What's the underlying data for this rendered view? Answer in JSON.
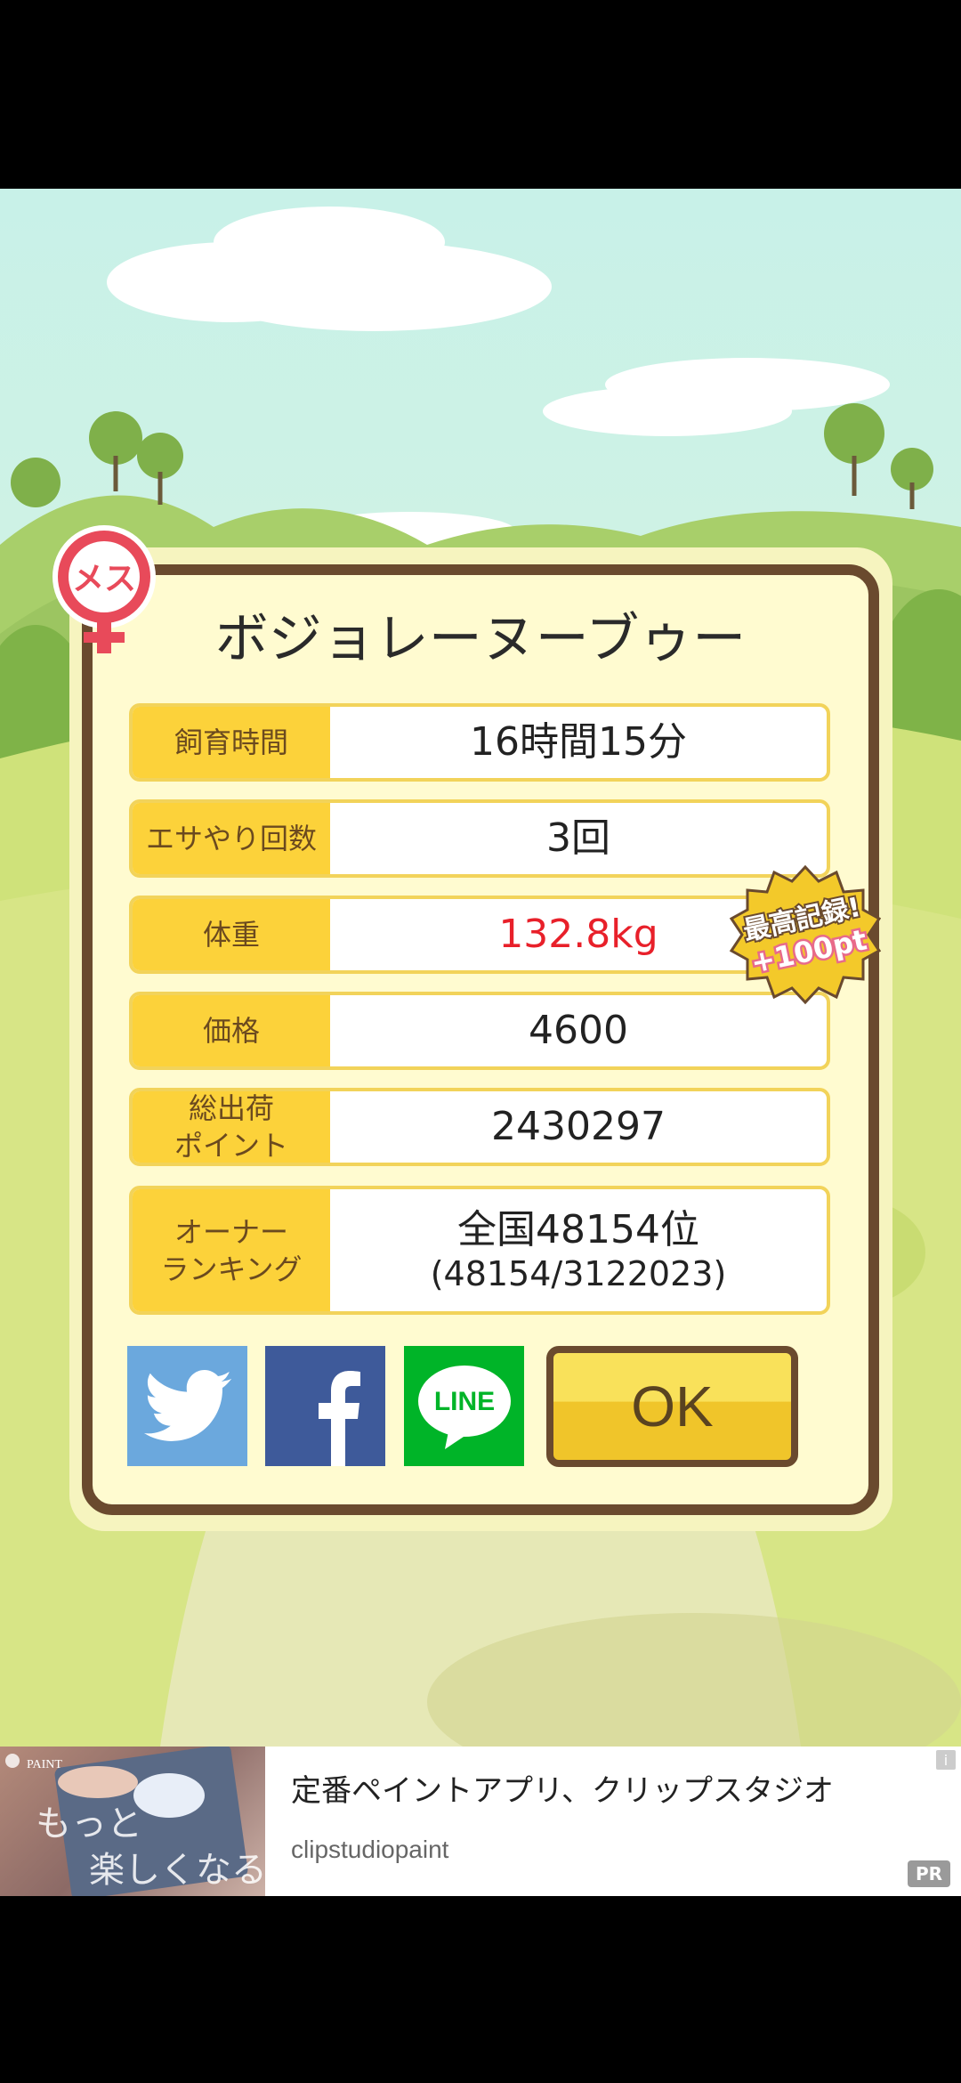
{
  "gender_badge": {
    "label": "メス"
  },
  "pig": {
    "name": "ボジョレーヌーブゥー"
  },
  "stats": [
    {
      "label": "飼育時間",
      "value": "16時間15分"
    },
    {
      "label": "エサやり回数",
      "value": "3回"
    },
    {
      "label": "体重",
      "value": "132.8kg"
    },
    {
      "label": "価格",
      "value": "4600"
    },
    {
      "label": "総出荷\nポイント",
      "value": "2430297"
    },
    {
      "label": "オーナー\nランキング",
      "value": "全国48154位",
      "value2": "(48154/3122023)"
    }
  ],
  "record_badge": {
    "line1": "最高記録!",
    "line2": "+100pt"
  },
  "buttons": {
    "ok_label": "OK",
    "line_label": "LINE"
  },
  "ad": {
    "title": "定番ペイントアプリ、クリップスタジオ",
    "domain": "clipstudiopaint",
    "pr_label": "PR",
    "image_text1": "もっと",
    "image_text2": "楽しくなる",
    "image_logo": "PAINT"
  },
  "colors": {
    "dialog_border": "#6a4a2e",
    "label_bg": "#fcd23a",
    "highlight": "#e8202a"
  }
}
